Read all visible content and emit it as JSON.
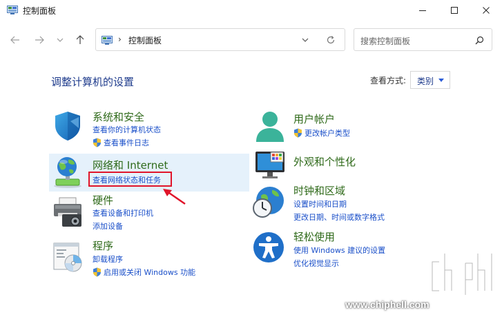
{
  "window": {
    "title": "控制面板"
  },
  "nav": {
    "address": "控制面板",
    "address_sep": "›",
    "search_placeholder": "搜索控制面板"
  },
  "main": {
    "heading": "调整计算机的设置",
    "view_by_label": "查看方式:",
    "view_by_value": "类别"
  },
  "categories": {
    "system": {
      "title": "系统和安全",
      "links": [
        "查看你的计算机状态",
        "查看事件日志"
      ]
    },
    "network": {
      "title": "网络和 Internet",
      "links": [
        "查看网络状态和任务"
      ]
    },
    "hardware": {
      "title": "硬件",
      "links": [
        "查看设备和打印机",
        "添加设备"
      ]
    },
    "programs": {
      "title": "程序",
      "links": [
        "卸载程序",
        "启用或关闭 Windows 功能"
      ]
    },
    "accounts": {
      "title": "用户帐户",
      "links": [
        "更改帐户类型"
      ]
    },
    "appearance": {
      "title": "外观和个性化",
      "links": []
    },
    "clock": {
      "title": "时钟和区域",
      "links": [
        "设置时间和日期",
        "更改日期、时间或数字格式"
      ]
    },
    "ease": {
      "title": "轻松使用",
      "links": [
        "使用 Windows 建议的设置",
        "优化视觉显示"
      ]
    }
  },
  "watermark": {
    "text": "www.chiphell.com"
  },
  "colors": {
    "heading": "#1e3b8c",
    "category_title": "#2f6a1a",
    "link": "#1a4fc9",
    "highlight": "#e5f1fb",
    "annotation": "#e0142a"
  }
}
